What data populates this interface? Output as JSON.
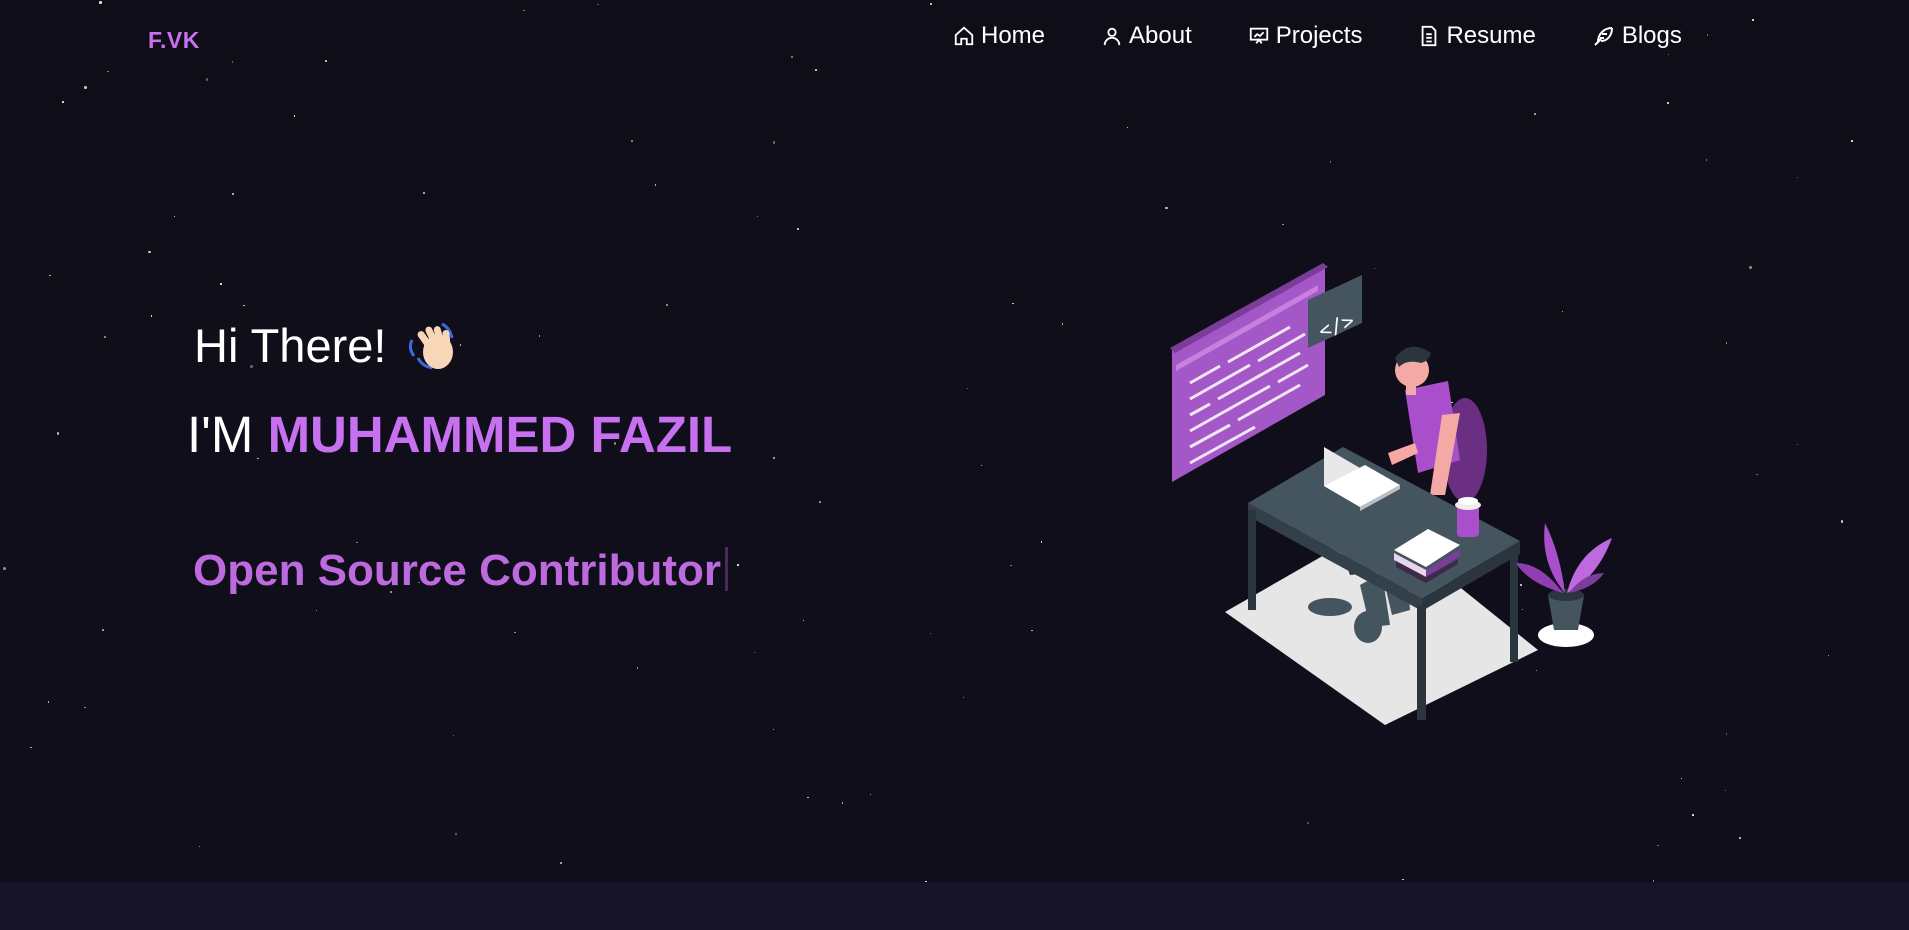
{
  "navbar": {
    "logo": "F.VK",
    "items": [
      {
        "label": "Home",
        "icon": "home-icon"
      },
      {
        "label": "About",
        "icon": "user-icon"
      },
      {
        "label": "Projects",
        "icon": "presentation-icon"
      },
      {
        "label": "Resume",
        "icon": "document-icon"
      },
      {
        "label": "Blogs",
        "icon": "feather-icon"
      }
    ]
  },
  "hero": {
    "greeting": "Hi There!",
    "name_prefix": "I'M",
    "name": "MUHAMMED FAZIL",
    "typewriter": "Open Source Contributor"
  },
  "colors": {
    "background": "#0f0d18",
    "accent": "#c770f0",
    "bottom_band": "#171328"
  }
}
